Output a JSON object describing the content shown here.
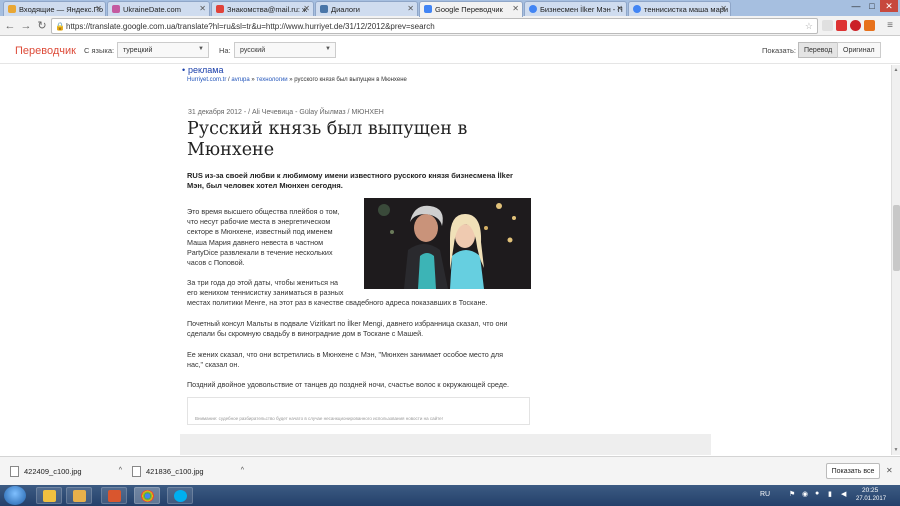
{
  "browser": {
    "tabs": [
      {
        "label": "Входящие — Яндекс.По",
        "color": "#e8a735"
      },
      {
        "label": "UkraineDate.com",
        "color": "#c45aa0"
      },
      {
        "label": "Знакомства@mail.ru: ж",
        "color": "#e0423a"
      },
      {
        "label": "Диалоги",
        "color": "#4a76a8"
      },
      {
        "label": "Google Переводчик",
        "color": "#4285f4"
      },
      {
        "label": "Бизнесмен İlker Мэн - П",
        "color": "#4285f4"
      },
      {
        "label": "теннисистка маша мари",
        "color": "#4285f4"
      }
    ],
    "window_controls": [
      "—",
      "□",
      "✕"
    ],
    "url": "https://translate.google.com.ua/translate?hl=ru&sl=tr&u=http://www.hurriyet.de/31/12/2012&prev=search"
  },
  "translate_bar": {
    "logo": "Переводчик",
    "from_label": "С языка:",
    "from_value": "турецкий",
    "to_label": "На:",
    "to_value": "русский",
    "show_label": "Показать:",
    "translation_btn": "Перевод",
    "original_btn": "Оригинал"
  },
  "article": {
    "top_link": "реклама",
    "breadcrumb": {
      "site": "Hurriyet.com.tr",
      "sep1": " /",
      "section": "avrupa",
      "sep2": " » ",
      "subsection": "технологии",
      "sep3": " » ",
      "current": "русского князя был выпущен в Мюнхене"
    },
    "dateline": "31 декабря 2012 - / Ali Чечевица - Gülay Йылмаз / МЮНХЕН",
    "headline": "Русский князь был выпущен в Мюнхене",
    "lead": "RUS из-за своей любви к любимому имени известного русского князя бизнесмена İlker Мэн, был человек хотел Мюнхен сегодня.",
    "p1_lines": [
      "Это время высшего общества плейбоя о том,",
      "что несут рабочие места в энергетическом",
      "секторе в Мюнхене, известный под именем",
      "Маша Мария давнего невеста в частном",
      "PartyDice развлекали в течение нескольких",
      "часов с Поповой."
    ],
    "p2_lines": [
      "За три года до этой даты, чтобы жениться на",
      "его женихом теннисистку заниматься в разных",
      "местах политики Менге, на этот раз в качестве свадебного адреса показавших в Тоскане."
    ],
    "p3_lines": [
      "Почетный консул Мальты в подвале Vizitkart по İlker Mengi, давнего избранница сказал, что они",
      "сделали бы скромную свадьбу в виноградние дом в Тоскане с Машей."
    ],
    "p4_lines": [
      "Ее жених сказал, что они встретились в Мюнхене с Мэн, \"Мюнхен занимает особое место для",
      "нас,\" сказал он."
    ],
    "p5": "Поздний двойное удовольствие от танцев до поздней ночи, счастье волос к окружающей среде.",
    "notice": "Внимание: судебное разбирательство будет начато в случае несанкционированного использования новости на сайте!"
  },
  "downloads": {
    "items": [
      "422409_c100.jpg",
      "421836_c100.jpg"
    ],
    "show_all": "Показать все"
  },
  "taskbar": {
    "lang": "RU",
    "time": "20:25",
    "date": "27.01.2017",
    "apps": [
      {
        "name": "explorer",
        "color": "#f0c040"
      },
      {
        "name": "library",
        "color": "#e8b04a"
      },
      {
        "name": "media",
        "color": "#d9562e"
      },
      {
        "name": "chrome",
        "color": "#4caf50"
      },
      {
        "name": "skype",
        "color": "#00aff0"
      }
    ]
  }
}
